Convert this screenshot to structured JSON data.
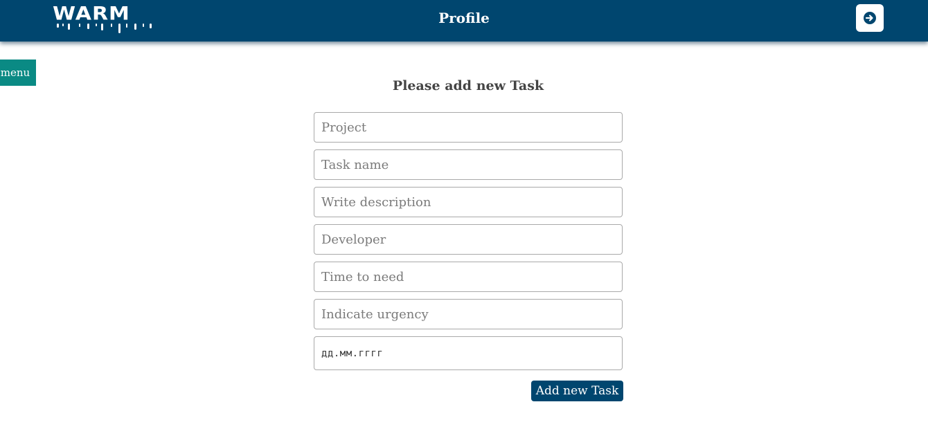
{
  "header": {
    "logo_text": "WARM",
    "title": "Profile",
    "logout_icon": "arrow-right-circle-icon"
  },
  "sidebar": {
    "menu_label": "menu"
  },
  "form": {
    "title": "Please add new Task",
    "fields": {
      "project": {
        "placeholder": "Project"
      },
      "task_name": {
        "placeholder": "Task name"
      },
      "description": {
        "placeholder": "Write description"
      },
      "developer": {
        "placeholder": "Developer"
      },
      "time_to_need": {
        "placeholder": "Time to need"
      },
      "urgency": {
        "placeholder": "Indicate urgency"
      },
      "date": {
        "placeholder": "дд.мм.гггг"
      }
    },
    "submit_label": "Add new Task"
  },
  "colors": {
    "header_bg": "#00466f",
    "menu_bg": "#0a8a84",
    "button_bg": "#00466f"
  }
}
